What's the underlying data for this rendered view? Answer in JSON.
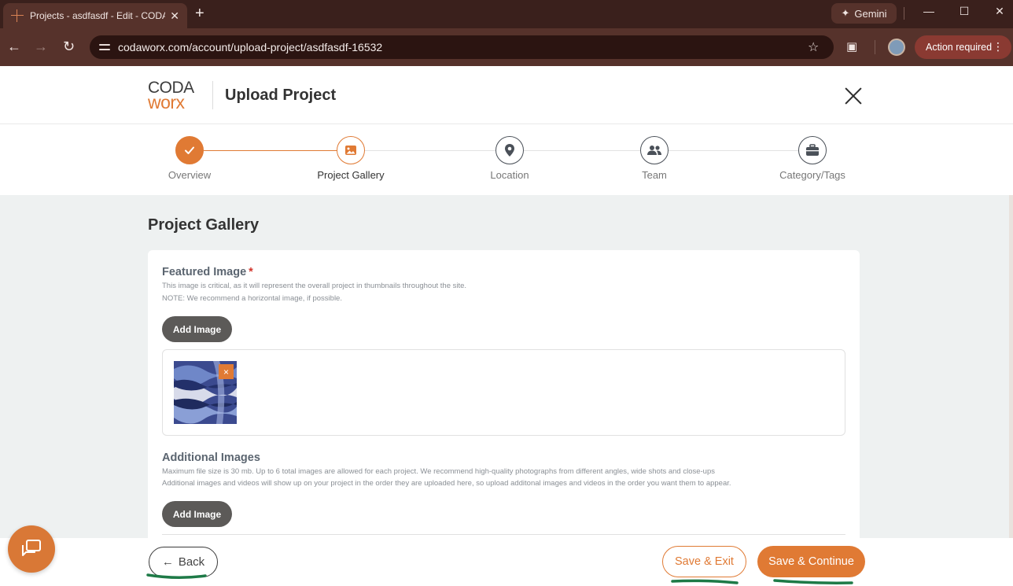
{
  "browser": {
    "tab_title": "Projects - asdfasdf - Edit - CODA",
    "new_tab": "+",
    "gemini_label": "Gemini",
    "url": "codaworx.com/account/upload-project/asdfasdf-16532",
    "action_required": "Action required"
  },
  "header": {
    "logo_top": "CODA",
    "logo_bottom": "worx",
    "title": "Upload Project"
  },
  "steps": [
    {
      "label": "Overview",
      "state": "done",
      "icon": "check-icon"
    },
    {
      "label": "Project Gallery",
      "state": "active",
      "icon": "image-icon"
    },
    {
      "label": "Location",
      "state": "pending",
      "icon": "location-pin-icon"
    },
    {
      "label": "Team",
      "state": "pending",
      "icon": "team-icon"
    },
    {
      "label": "Category/Tags",
      "state": "pending",
      "icon": "briefcase-icon"
    }
  ],
  "gallery": {
    "section_title": "Project Gallery",
    "featured": {
      "title": "Featured Image",
      "required_mark": "*",
      "hint1": "This image is critical, as it will represent the overall project in thumbnails throughout the site.",
      "hint2": "NOTE: We recommend a horizontal image, if possible.",
      "add_label": "Add Image",
      "remove_label": "×"
    },
    "additional": {
      "title": "Additional Images",
      "hint1": "Maximum file size is 30 mb. Up to 6 total images are allowed for each project. We recommend high-quality photographs from different angles, wide shots and close-ups",
      "hint2": "Additional images and videos will show up on your project in the order they are uploaded here, so upload additonal images and videos in the order you want them to appear.",
      "add_label": "Add Image"
    }
  },
  "footer": {
    "back_label": "Back",
    "back_arrow": "←",
    "save_exit_label": "Save & Exit",
    "save_continue_label": "Save & Continue"
  },
  "colors": {
    "accent": "#e07a34",
    "chrome_dark": "#3a201c",
    "chrome": "#56322b",
    "annotation_green": "#1e7a47"
  }
}
